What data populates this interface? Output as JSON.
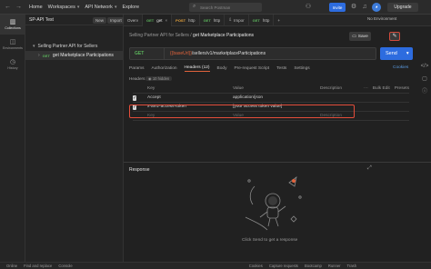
{
  "topbar": {
    "home": "Home",
    "workspaces": "Workspaces",
    "api_network": "API Network",
    "explore": "Explore",
    "search_placeholder": "Search Postman",
    "invite": "Invite",
    "upgrade": "Upgrade"
  },
  "rail": {
    "items": [
      {
        "label": "Collections",
        "icon": "collections-icon"
      },
      {
        "label": "Environments",
        "icon": "environments-icon"
      },
      {
        "label": "History",
        "icon": "history-icon"
      }
    ]
  },
  "sidebar": {
    "workspace": "SP-API Test",
    "new": "New",
    "import": "Import",
    "collection": "Selling Partner API for Sellers",
    "request_method": "GET",
    "request_name": "get Marketplace Participations"
  },
  "tabs": [
    {
      "label": "Overv",
      "method": ""
    },
    {
      "label": "get",
      "method": "GET"
    },
    {
      "label": "http",
      "method": "POST"
    },
    {
      "label": "http",
      "method": "GET"
    },
    {
      "label": "Impor",
      "method": ""
    },
    {
      "label": "http",
      "method": "GET"
    }
  ],
  "environment": "No Environment",
  "breadcrumb": {
    "parent": "Selling Partner API for Sellers",
    "sep": "/",
    "current": "get Marketplace Participations"
  },
  "save_label": "Save",
  "request": {
    "method": "GET",
    "url_var": "{{baseUrl}}",
    "url_path": "/sellers/v1/marketplaceParticipations",
    "send": "Send"
  },
  "subtabs": [
    "Params",
    "Authorization",
    "Headers (12)",
    "Body",
    "Pre-request Script",
    "Tests",
    "Settings"
  ],
  "cookies": "Cookies",
  "headers_label": "Headers",
  "hidden_label": "10 hidden",
  "table": {
    "columns": [
      "Key",
      "Value",
      "Description"
    ],
    "bulk_edit": "Bulk Edit",
    "presets": "Presets",
    "rows": [
      {
        "key": "Accept",
        "value": "application/json"
      },
      {
        "key": "x-amz-access-token",
        "value": "[your access token value]"
      }
    ],
    "placeholder_key": "Key",
    "placeholder_value": "Value",
    "placeholder_desc": "Description"
  },
  "response": {
    "title": "Response",
    "message": "Click Send to get a response"
  },
  "statusbar": {
    "online": "Online",
    "find_replace": "Find and replace",
    "console": "Console",
    "cookies": "Cookies",
    "capture": "Capture requests",
    "bootcamp": "Bootcamp",
    "runner": "Runner",
    "trash": "Trash"
  },
  "colors": {
    "accent": "#2d6cdf",
    "get": "#5bb35b",
    "post": "#e6a33c",
    "variable": "#e0633c",
    "highlight": "#e44d3a"
  }
}
